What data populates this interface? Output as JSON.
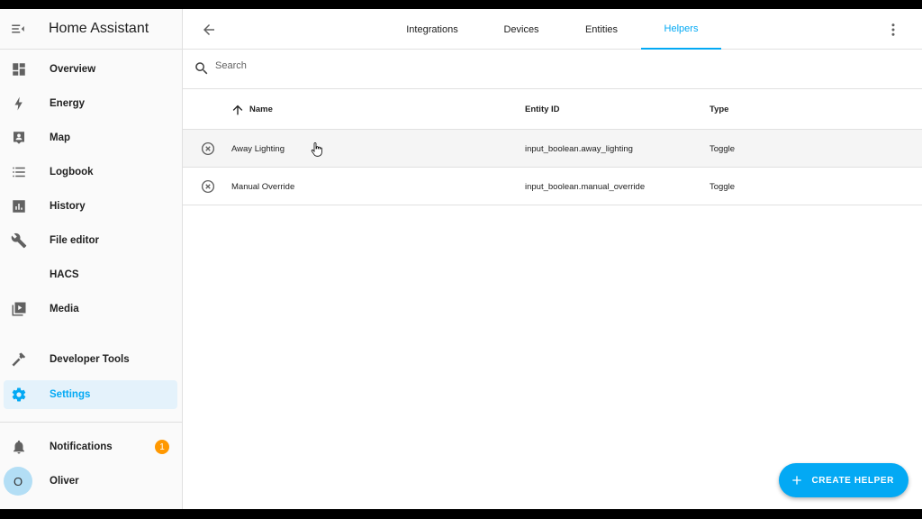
{
  "app": {
    "title": "Home Assistant"
  },
  "sidebar": {
    "items": [
      {
        "label": "Overview",
        "icon": "dashboard-icon"
      },
      {
        "label": "Energy",
        "icon": "lightning-icon"
      },
      {
        "label": "Map",
        "icon": "map-person-icon"
      },
      {
        "label": "Logbook",
        "icon": "list-icon"
      },
      {
        "label": "History",
        "icon": "bar-chart-icon"
      },
      {
        "label": "File editor",
        "icon": "wrench-icon"
      },
      {
        "label": "HACS",
        "icon": ""
      },
      {
        "label": "Media",
        "icon": "play-box-icon"
      },
      {
        "label": "Developer Tools",
        "icon": "hammer-icon"
      },
      {
        "label": "Settings",
        "icon": "gear-icon",
        "active": true
      }
    ],
    "notifications": {
      "label": "Notifications",
      "count": "1"
    },
    "user": {
      "name": "Oliver",
      "initial": "O"
    }
  },
  "tabs": [
    {
      "label": "Integrations"
    },
    {
      "label": "Devices"
    },
    {
      "label": "Entities"
    },
    {
      "label": "Helpers",
      "active": true
    }
  ],
  "search": {
    "placeholder": "Search"
  },
  "table": {
    "columns": {
      "name": "Name",
      "entity_id": "Entity ID",
      "type": "Type"
    },
    "rows": [
      {
        "name": "Away Lighting",
        "entity_id": "input_boolean.away_lighting",
        "type": "Toggle"
      },
      {
        "name": "Manual Override",
        "entity_id": "input_boolean.manual_override",
        "type": "Toggle"
      }
    ]
  },
  "fab": {
    "label": "CREATE HELPER"
  },
  "colors": {
    "accent": "#03a9f4",
    "badge": "#ff9800",
    "active_bg": "#e4f2fb"
  }
}
